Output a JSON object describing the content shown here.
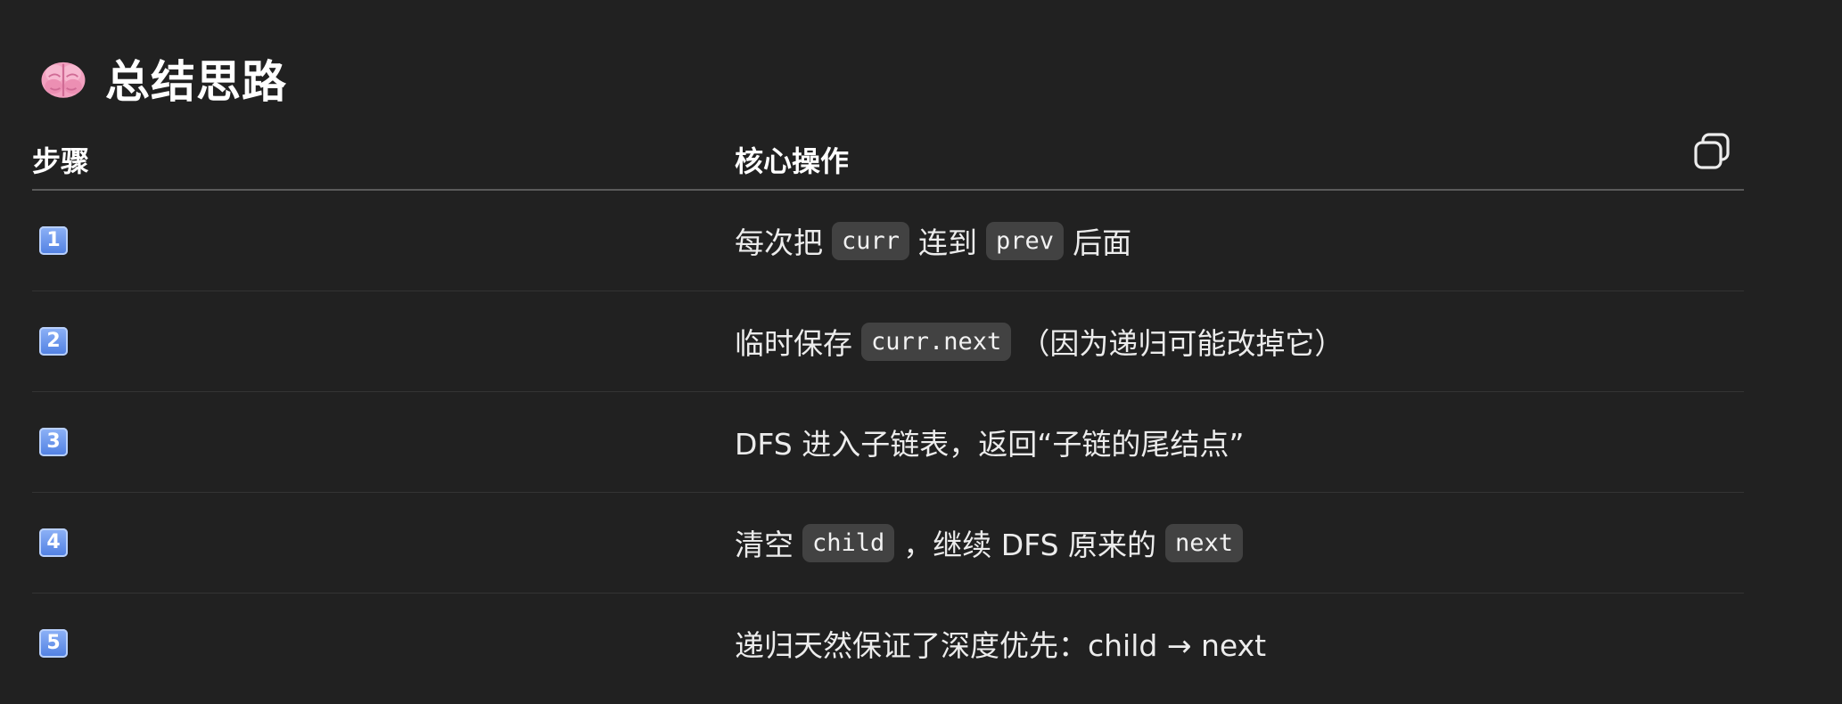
{
  "heading": {
    "icon": "brain-icon",
    "title": "总结思路"
  },
  "table": {
    "headers": {
      "step": "步骤",
      "op": "核心操作"
    },
    "copy_icon": "copy-icon",
    "rows": [
      {
        "step": "1",
        "parts": [
          "每次把",
          "curr",
          "连到",
          "prev",
          "后面"
        ]
      },
      {
        "step": "2",
        "parts": [
          "临时保存",
          "curr.next",
          "（因为递归可能改掉它）"
        ]
      },
      {
        "step": "3",
        "parts": [
          "DFS 进入子链表，返回“子链的尾结点”"
        ]
      },
      {
        "step": "4",
        "parts": [
          "清空",
          "child",
          "，继续 DFS 原来的",
          "next"
        ]
      },
      {
        "step": "5",
        "parts": [
          "递归天然保证了深度优先：child → next"
        ]
      }
    ]
  }
}
